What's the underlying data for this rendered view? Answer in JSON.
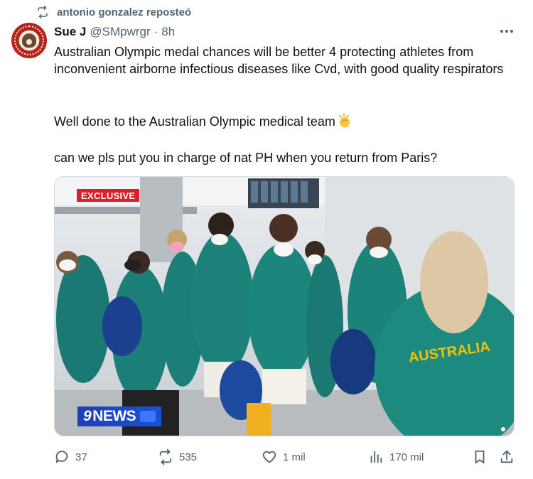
{
  "repost": {
    "label": "antonio gonzalez reposteó",
    "icon": "repost-icon"
  },
  "tweet": {
    "author_name": "Sue J",
    "handle": "@SMpwrgr",
    "separator": "·",
    "time": "8h",
    "paragraphs": [
      "Australian Olympic medal chances will be better 4 protecting athletes from inconvenient airborne infectious diseases like Cvd, with good quality respirators",
      "Well done to the Australian Olympic medical team",
      "can we pls put you in charge of nat PH when you return from Paris?"
    ],
    "emoji": "clapping-hands",
    "media": {
      "badge": "EXCLUSIVE",
      "logo_text": "NEWS",
      "logo_number": "9",
      "shirt_text": "AUSTRALIA"
    }
  },
  "actions": {
    "replies": "37",
    "reposts": "535",
    "likes": "1 mil",
    "views": "170 mil"
  },
  "colors": {
    "muted": "#536471",
    "text": "#0f1419",
    "shirt": "#1b7f77",
    "exclusive_red": "#d8202a",
    "news_blue": "#1e3fb8"
  }
}
